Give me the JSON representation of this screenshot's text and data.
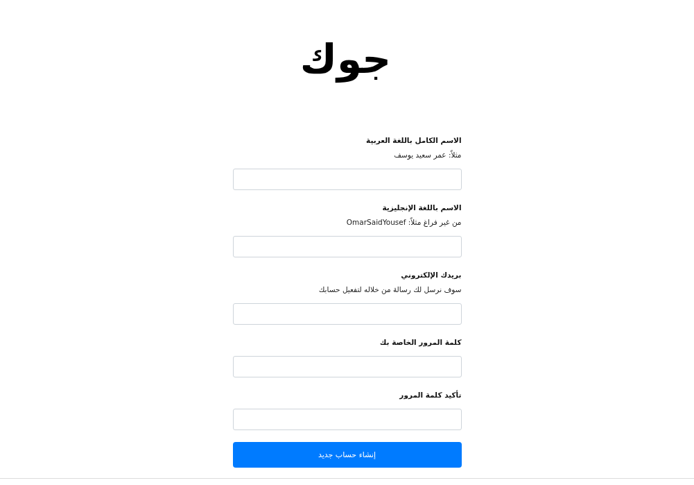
{
  "logo": {
    "text": "جوك"
  },
  "form": {
    "fields": [
      {
        "label": "الاسم الكامل باللغة العربية",
        "hint": "مثلاً: عمر سعيد يوسف"
      },
      {
        "label": "الاسم باللغة الإنجليزية",
        "hint": "من غير فراغ مثلاً: OmarSaidYousef"
      },
      {
        "label": "بريدك الإلكتروني",
        "hint": "سوف نرسل لك رسالة من خلاله لتفعيل حسابك"
      },
      {
        "label": "كلمة المرور الخاصة بك"
      },
      {
        "label": "تأكيد كلمة المرور"
      }
    ],
    "submit_button": "إنشاء حساب جديد"
  }
}
